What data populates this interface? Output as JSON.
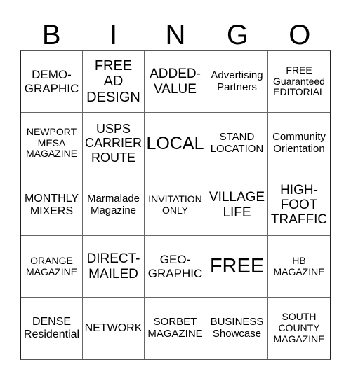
{
  "header": {
    "letters": [
      "B",
      "I",
      "N",
      "G",
      "O"
    ]
  },
  "board": {
    "rows": [
      [
        {
          "text": "DEMO-\nGRAPHIC",
          "size": "s17"
        },
        {
          "text": "FREE\nAD\nDESIGN",
          "size": "s20"
        },
        {
          "text": "ADDED-\nVALUE",
          "size": "s19"
        },
        {
          "text": "Advertising\nPartners",
          "size": "s15"
        },
        {
          "text": "FREE\nGuaranteed\nEDITORIAL",
          "size": "s14"
        }
      ],
      [
        {
          "text": "NEWPORT\nMESA\nMAGAZINE",
          "size": "s14"
        },
        {
          "text": "USPS\nCARRIER\nROUTE",
          "size": "s18"
        },
        {
          "text": "LOCAL",
          "size": "s25"
        },
        {
          "text": "STAND\nLOCATION",
          "size": "s15"
        },
        {
          "text": "Community\nOrientation",
          "size": "s15"
        }
      ],
      [
        {
          "text": "MONTHLY\nMIXERS",
          "size": "s16"
        },
        {
          "text": "Marmalade\nMagazine",
          "size": "s15"
        },
        {
          "text": "INVITATION\nONLY",
          "size": "s14"
        },
        {
          "text": "VILLAGE\nLIFE",
          "size": "s19"
        },
        {
          "text": "HIGH-\nFOOT\nTRAFFIC",
          "size": "s19"
        }
      ],
      [
        {
          "text": "ORANGE\nMAGAZINE",
          "size": "s14"
        },
        {
          "text": "DIRECT-\nMAILED",
          "size": "s19"
        },
        {
          "text": "GEO-\nGRAPHIC",
          "size": "s17"
        },
        {
          "text": "FREE",
          "size": "s28"
        },
        {
          "text": "HB\nMAGAZINE",
          "size": "s14"
        }
      ],
      [
        {
          "text": "DENSE\nResidential",
          "size": "s16"
        },
        {
          "text": "NETWORK",
          "size": "s16"
        },
        {
          "text": "SORBET\nMAGAZINE",
          "size": "s15"
        },
        {
          "text": "BUSINESS\nShowcase",
          "size": "s15"
        },
        {
          "text": "SOUTH\nCOUNTY\nMAGAZINE",
          "size": "s14"
        }
      ]
    ]
  }
}
